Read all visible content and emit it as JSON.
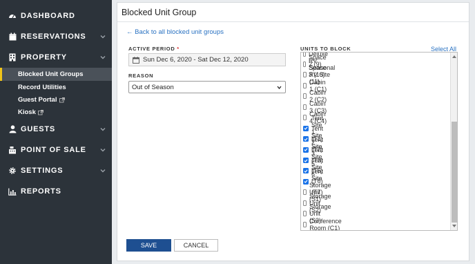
{
  "sidebar": {
    "items": [
      {
        "label": "DASHBOARD",
        "icon": "dashboard-icon",
        "has_chevron": false
      },
      {
        "label": "RESERVATIONS",
        "icon": "calendar-icon",
        "has_chevron": true
      },
      {
        "label": "PROPERTY",
        "icon": "building-icon",
        "has_chevron": true
      },
      {
        "label": "GUESTS",
        "icon": "user-icon",
        "has_chevron": true
      },
      {
        "label": "POINT OF SALE",
        "icon": "cash-register-icon",
        "has_chevron": true
      },
      {
        "label": "SETTINGS",
        "icon": "gear-icon",
        "has_chevron": true
      },
      {
        "label": "REPORTS",
        "icon": "bar-chart-icon",
        "has_chevron": false
      }
    ],
    "property_subitems": [
      {
        "label": "Blocked Unit Groups",
        "active": true,
        "external": false
      },
      {
        "label": "Record Utilities",
        "active": false,
        "external": false
      },
      {
        "label": "Guest Portal",
        "active": false,
        "external": true
      },
      {
        "label": "Kiosk",
        "active": false,
        "external": true
      }
    ],
    "accent_color": "#f0c419"
  },
  "page": {
    "title": "Blocked Unit Group",
    "back_link": "← Back to all blocked unit groups"
  },
  "form": {
    "active_period_label": "ACTIVE PERIOD",
    "required_marker": "*",
    "active_period_value": "Sun Dec 6, 2020 - Sat Dec 12, 2020",
    "reason_label": "REASON",
    "reason_value": "Out of Season",
    "units_label": "UNITS TO BLOCK",
    "select_all": "Select All",
    "units": [
      {
        "label": "Deluxe RV Space 2 (9)",
        "checked": false
      },
      {
        "label": "Deluxe RV Space 3 (10)",
        "checked": false
      },
      {
        "label": "Seasonal RV Site (11)",
        "checked": false
      },
      {
        "label": "Cabin 1 (C1)",
        "checked": false
      },
      {
        "label": "Cabin 2 (C2)",
        "checked": false
      },
      {
        "label": "Cabin 3 (C3)",
        "checked": false
      },
      {
        "label": "Cabin 4 (C4)",
        "checked": false
      },
      {
        "label": "Tent Site 1 (T1)",
        "checked": true
      },
      {
        "label": "Tent Site 2 (T2)",
        "checked": true
      },
      {
        "label": "Tent Site 3 (T3)",
        "checked": true
      },
      {
        "label": "Tent Site 5 (T5)",
        "checked": true
      },
      {
        "label": "Tent Site 6 (T6)",
        "checked": true
      },
      {
        "label": "Tent Site 7 (T7)",
        "checked": true
      },
      {
        "label": "Storage Unit (S1)",
        "checked": false
      },
      {
        "label": "Storage Unit (S2)",
        "checked": false
      },
      {
        "label": "Storage Unit (S3)",
        "checked": false
      },
      {
        "label": "Conference Room (C1)",
        "checked": false
      }
    ],
    "save_label": "SAVE",
    "cancel_label": "CANCEL"
  },
  "colors": {
    "sidebar_bg": "#2c333a",
    "link": "#2a72c2",
    "primary_button": "#1e4f91",
    "checkbox_checked": "#1a73e8"
  }
}
